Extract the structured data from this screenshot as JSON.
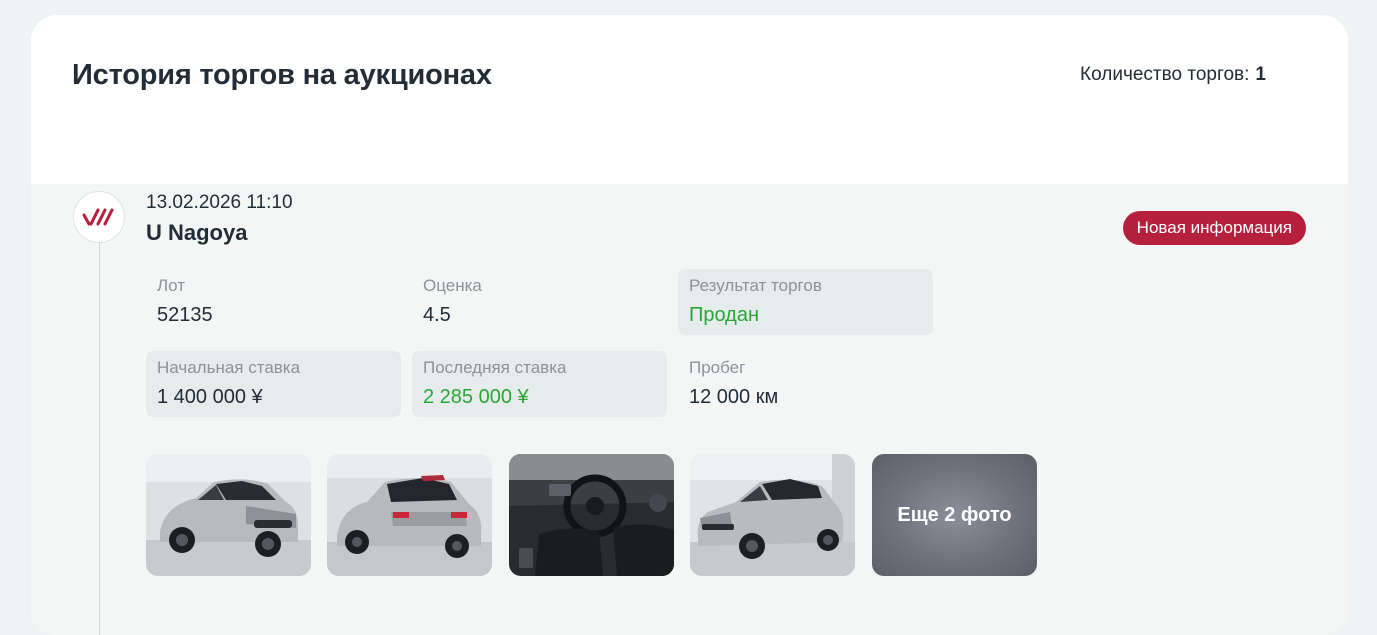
{
  "section": {
    "title": "История торгов на аукционах",
    "count_label": "Количество торгов:",
    "count_value": "1"
  },
  "entry": {
    "date": "13.02.2026 11:10",
    "auction": "U Nagoya",
    "badge": "Новая информация",
    "logo_icon": "auction-house-logo-icon",
    "fields": {
      "lot": {
        "label": "Лот",
        "value": "52135"
      },
      "grade": {
        "label": "Оценка",
        "value": "4.5"
      },
      "result": {
        "label": "Результат торгов",
        "value": "Продан"
      },
      "start_bid": {
        "label": "Начальная ставка",
        "value": "1 400 000 ¥"
      },
      "last_bid": {
        "label": "Последняя ставка",
        "value": "2 285 000 ¥"
      },
      "mileage": {
        "label": "Пробег",
        "value": "12 000 км"
      }
    },
    "photos": {
      "more_label": "Еще 2 фото"
    }
  },
  "colors": {
    "accent": "#b5203c",
    "success": "#2aa637"
  }
}
